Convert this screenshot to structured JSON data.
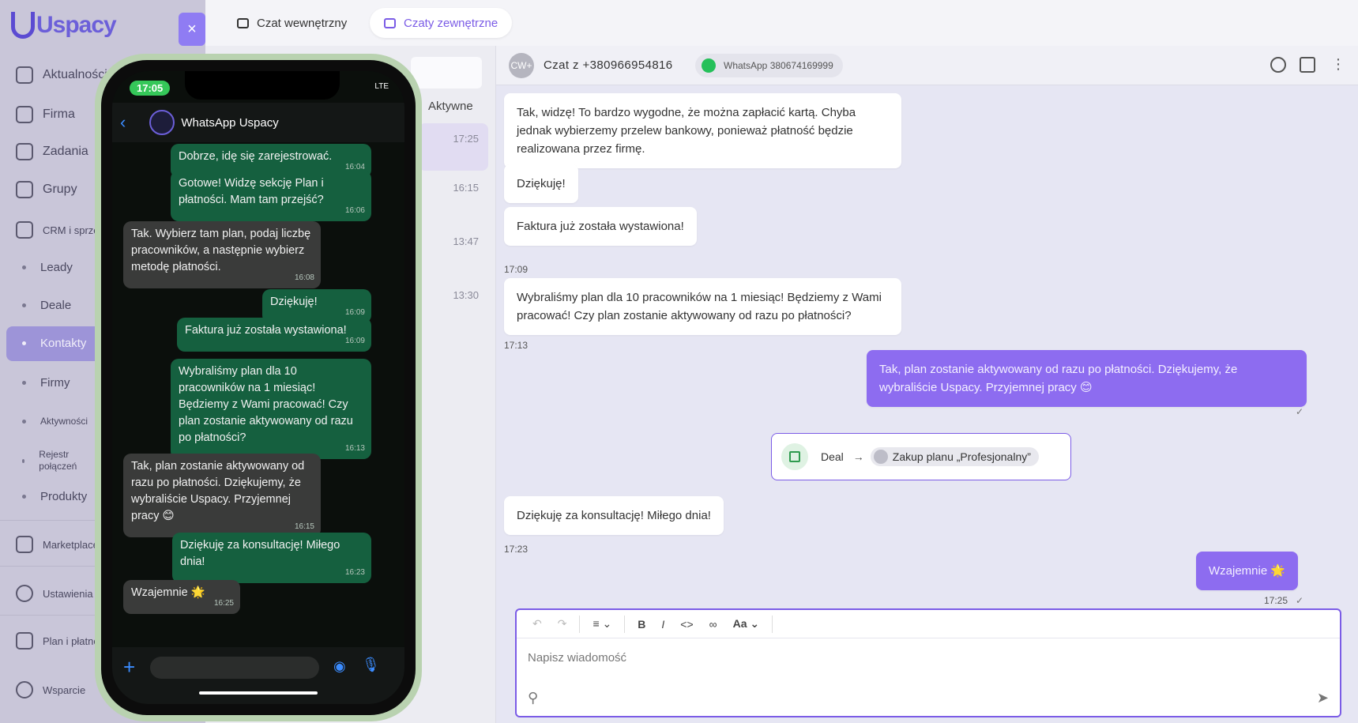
{
  "app": {
    "logo": "Uspacy"
  },
  "sidebar": {
    "items": [
      {
        "label": "Aktualności"
      },
      {
        "label": "Firma"
      },
      {
        "label": "Zadania"
      },
      {
        "label": "Grupy"
      },
      {
        "label": "CRM i sprzedaż"
      },
      {
        "label": "Leady"
      },
      {
        "label": "Deale"
      },
      {
        "label": "Kontakty"
      },
      {
        "label": "Firmy"
      },
      {
        "label": "Aktywności"
      },
      {
        "label": "Rejestr połączeń"
      },
      {
        "label": "Produkty"
      },
      {
        "label": "Marketplace"
      },
      {
        "label": "Ustawienia"
      },
      {
        "label": "Plan i płatności"
      },
      {
        "label": "Wsparcie"
      }
    ],
    "close_label": "×"
  },
  "tabs": [
    {
      "label": "Czat wewnętrzny"
    },
    {
      "label": "Czaty zewnętrzne"
    }
  ],
  "chat_list": {
    "filter_label": "Aktywne",
    "times": [
      "17:25",
      "16:15",
      "13:47",
      "13:30"
    ]
  },
  "chat": {
    "avatar": "CW+",
    "title": "Czat z +380966954816",
    "channel": "WhatsApp 380674169999",
    "messages": [
      {
        "text": "Tak, widzę! To bardzo wygodne, że można zapłacić kartą. Chyba jednak wybierzemy przelew bankowy, ponieważ płatność będzie realizowana przez firmę."
      },
      {
        "text": "Dziękuję!"
      },
      {
        "text": "Faktura już została wystawiona!",
        "time": "17:09"
      },
      {
        "text": "Wybraliśmy plan dla 10 pracowników na 1 miesiąc! Będziemy z Wami pracować! Czy plan zostanie aktywowany od razu po płatności?",
        "time": "17:13"
      },
      {
        "text": "Tak, plan zostanie aktywowany od razu po płatności. Dziękujemy, że wybraliście Uspacy. Przyjemnej pracy 😊"
      },
      {
        "text": "Dziękuję za konsultację! Miłego dnia!",
        "time": "17:23"
      },
      {
        "text": "Wzajemnie 🌟",
        "time": "17:25"
      }
    ],
    "deal": {
      "label": "Deal",
      "name": "Zakup planu „Profesjonalny”"
    },
    "composer": {
      "placeholder": "Napisz wiadomość",
      "font_label": "Aa",
      "bold": "B",
      "italic": "I"
    }
  },
  "phone": {
    "status_time": "17:05",
    "network": "LTE",
    "contact": "WhatsApp Uspacy",
    "messages": [
      {
        "text": "Dobrze, idę się zarejestrować.",
        "time": "16:04"
      },
      {
        "text": "Gotowe! Widzę sekcję Plan i płatności. Mam tam przejść?",
        "time": "16:06"
      },
      {
        "text": "Tak. Wybierz tam plan, podaj liczbę pracowników, a następnie wybierz metodę płatności.",
        "time": "16:08"
      },
      {
        "text": "Dziękuję!",
        "time": "16:09"
      },
      {
        "text": "Faktura już została wystawiona!",
        "time": "16:09"
      },
      {
        "text": "Wybraliśmy plan dla 10 pracowników na 1 miesiąc! Będziemy z Wami pracować! Czy plan zostanie aktywowany od razu po płatności?",
        "time": "16:13"
      },
      {
        "text": "Tak, plan zostanie aktywowany od razu po płatności. Dziękujemy, że wybraliście Uspacy. Przyjemnej pracy 😊",
        "time": "16:15"
      },
      {
        "text": "Dziękuję za konsultację! Miłego dnia!",
        "time": "16:23"
      },
      {
        "text": "Wzajemnie 🌟",
        "time": "16:25"
      }
    ]
  }
}
